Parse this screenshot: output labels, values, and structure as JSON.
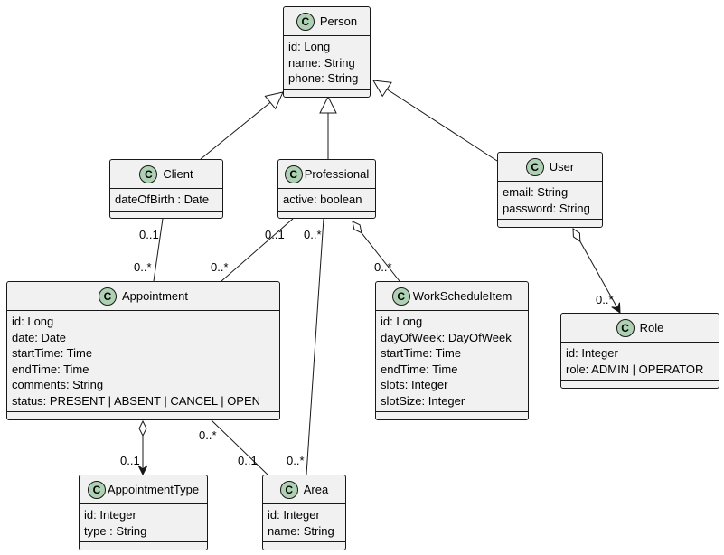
{
  "classes": {
    "person": {
      "name": "Person",
      "stereotype_icon": "C",
      "attributes": [
        "id: Long",
        "name: String",
        "phone: String"
      ]
    },
    "client": {
      "name": "Client",
      "stereotype_icon": "C",
      "attributes": [
        "dateOfBirth : Date"
      ]
    },
    "professional": {
      "name": "Professional",
      "stereotype_icon": "C",
      "attributes": [
        "active: boolean"
      ]
    },
    "user": {
      "name": "User",
      "stereotype_icon": "C",
      "attributes": [
        "email: String",
        "password: String"
      ]
    },
    "appointment": {
      "name": "Appointment",
      "stereotype_icon": "C",
      "attributes": [
        "id: Long",
        "date: Date",
        "startTime: Time",
        "endTime: Time",
        "comments: String",
        "status: PRESENT | ABSENT | CANCEL | OPEN"
      ]
    },
    "workscheduleitem": {
      "name": "WorkScheduleItem",
      "stereotype_icon": "C",
      "attributes": [
        "id: Long",
        "dayOfWeek: DayOfWeek",
        "startTime: Time",
        "endTime: Time",
        "slots: Integer",
        "slotSize: Integer"
      ]
    },
    "role": {
      "name": "Role",
      "stereotype_icon": "C",
      "attributes": [
        "id: Integer",
        "role: ADMIN | OPERATOR"
      ]
    },
    "appointmenttype": {
      "name": "AppointmentType",
      "stereotype_icon": "C",
      "attributes": [
        "id: Integer",
        "type : String"
      ]
    },
    "area": {
      "name": "Area",
      "stereotype_icon": "C",
      "attributes": [
        "id: Integer",
        "name: String"
      ]
    }
  },
  "relations": [
    {
      "from": "Client",
      "to": "Person",
      "type": "inheritance"
    },
    {
      "from": "Professional",
      "to": "Person",
      "type": "inheritance"
    },
    {
      "from": "User",
      "to": "Person",
      "type": "inheritance"
    },
    {
      "from": "Client",
      "to": "Appointment",
      "type": "association",
      "from_mult": "0..1",
      "to_mult": "0..*"
    },
    {
      "from": "Professional",
      "to": "Appointment",
      "type": "association",
      "from_mult": "0..1",
      "to_mult": "0..*"
    },
    {
      "from": "Professional",
      "to": "Area",
      "type": "association",
      "from_mult": "0..*",
      "to_mult": "0..*"
    },
    {
      "from": "Professional",
      "to": "WorkScheduleItem",
      "type": "aggregation",
      "to_mult": "0..*"
    },
    {
      "from": "User",
      "to": "Role",
      "type": "aggregation-directed",
      "to_mult": "0..*"
    },
    {
      "from": "Appointment",
      "to": "AppointmentType",
      "type": "aggregation-directed",
      "to_mult": "0..1"
    },
    {
      "from": "Appointment",
      "to": "Area",
      "type": "association",
      "from_mult": "0..*",
      "to_mult": "0..1"
    }
  ],
  "multiplicities": {
    "client_appt_top": "0..1",
    "client_appt_bottom": "0..*",
    "prof_appt_top": "0..1",
    "prof_appt_bottom": "0..*",
    "prof_area_top": "0..*",
    "prof_area_bottom": "0..*",
    "prof_wsi": "0..*",
    "user_role": "0..*",
    "appt_type": "0..1",
    "appt_area_top": "0..*",
    "appt_area_bottom": "0..1"
  },
  "colors": {
    "class_bg": "#f1f1f1",
    "icon_bg": "#add1b2",
    "border": "#181818"
  }
}
